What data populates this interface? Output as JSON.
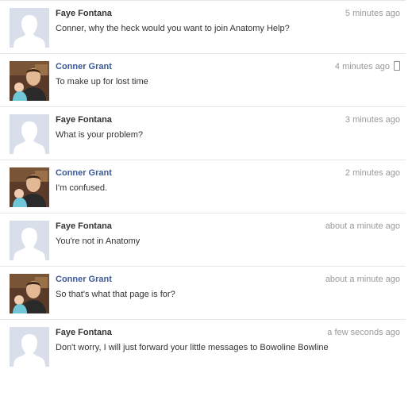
{
  "messages": [
    {
      "author": "Faye Fontana",
      "time": "5 minutes ago",
      "text": "Conner, why the heck would you want to join Anatomy Help?",
      "avatar": "default-silhouette",
      "mobile": false
    },
    {
      "author": "Conner Grant",
      "time": "4 minutes ago",
      "text": "To make up for lost time",
      "avatar": "photo",
      "mobile": true
    },
    {
      "author": "Faye Fontana",
      "time": "3 minutes ago",
      "text": "What is your problem?",
      "avatar": "default-silhouette",
      "mobile": false
    },
    {
      "author": "Conner Grant",
      "time": "2 minutes ago",
      "text": "I'm confused.",
      "avatar": "photo",
      "mobile": false
    },
    {
      "author": "Faye Fontana",
      "time": "about a minute ago",
      "text": "You're not in Anatomy",
      "avatar": "default-silhouette",
      "mobile": false
    },
    {
      "author": "Conner Grant",
      "time": "about a minute ago",
      "text": "So that's what that page is for?",
      "avatar": "photo",
      "mobile": false
    },
    {
      "author": "Faye Fontana",
      "time": "a few seconds ago",
      "text": "Don't worry, I will just forward your little messages to Bowoline Bowline",
      "avatar": "default-silhouette",
      "mobile": false
    }
  ],
  "colors": {
    "conner_name": "#3b5998",
    "faye_name": "#333333",
    "timestamp": "#999999",
    "divider": "#e7e7e7",
    "silhouette_bg": "#d8dfea",
    "silhouette_fg": "#ffffff"
  },
  "icons": {
    "mobile": "mobile-phone-icon"
  }
}
